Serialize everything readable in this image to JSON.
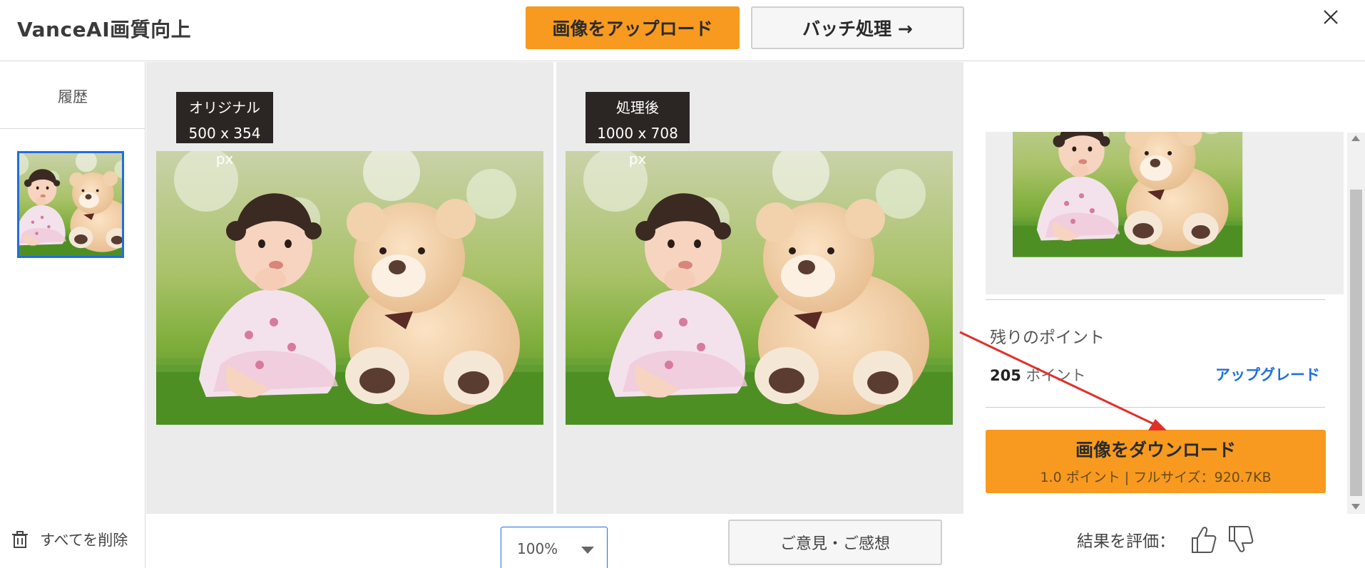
{
  "header": {
    "app_title": "VanceAI画質向上",
    "upload_label": "画像をアップロード",
    "batch_label": "バッチ処理 →"
  },
  "sidebar": {
    "history_label": "履歴",
    "delete_all_label": "すべてを削除"
  },
  "compare": {
    "original": {
      "title": "オリジナル",
      "size": "500 x 354 px"
    },
    "processed": {
      "title": "処理後",
      "size": "1000 x 708 px"
    }
  },
  "bottombar": {
    "zoom_value": "100%",
    "feedback_label": "ご意見・ご感想"
  },
  "panel": {
    "remaining_label": "残りのポイント",
    "points_value": "205",
    "points_unit": "ポイント",
    "upgrade_label": "アップグレード",
    "download_title": "画像をダウンロード",
    "download_sub": "1.0 ポイント | フルサイズ：920.7KB",
    "rate_label": "結果を評価："
  },
  "icons": {
    "close": "close-icon",
    "trash": "trash-icon",
    "zoom_caret": "chevron-down-icon",
    "like": "thumbs-up-icon",
    "dislike": "thumbs-down-icon",
    "annotation": "red-arrow-icon"
  },
  "colors": {
    "accent_orange": "#f79a1f",
    "link_blue": "#1f6fe0",
    "tag_bg": "#2b2624",
    "annotation_red": "#e0302a"
  }
}
